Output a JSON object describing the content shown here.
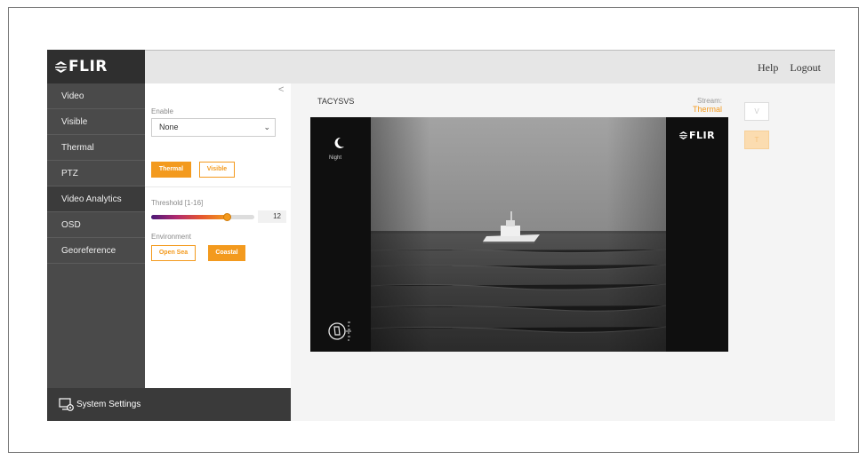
{
  "brand": {
    "logo_text": "FLIR"
  },
  "header": {
    "help": "Help",
    "logout": "Logout"
  },
  "sidebar": {
    "items": [
      {
        "label": "Video"
      },
      {
        "label": "Visible"
      },
      {
        "label": "Thermal"
      },
      {
        "label": "PTZ"
      },
      {
        "label": "Video Analytics",
        "active": true
      },
      {
        "label": "OSD"
      },
      {
        "label": "Georeference"
      }
    ],
    "footer_label": "System Settings"
  },
  "panel": {
    "collapse_icon": "<",
    "enable": {
      "label": "Enable",
      "value": "None"
    },
    "camera_buttons": {
      "thermal": "Thermal",
      "visible": "Visible",
      "selected": "thermal"
    },
    "threshold": {
      "label": "Threshold [1-16]",
      "value": "12",
      "min": 1,
      "max": 16
    },
    "environment": {
      "label": "Environment",
      "open_sea": "Open Sea",
      "coastal": "Coastal",
      "selected": "coastal"
    }
  },
  "main": {
    "stream_name": "TACYSVS",
    "stream_label": "Stream:",
    "stream_value": "Thermal",
    "side_buttons": {
      "v": "V",
      "t": "T"
    },
    "video": {
      "night_label": "Night",
      "logo_text": "FLIR",
      "mode_icon": "moon-icon",
      "compass_icon": "compass-icon"
    }
  },
  "colors": {
    "accent": "#f39a1e",
    "sidebar": "#4a4a4a",
    "header": "#e6e6e6"
  }
}
